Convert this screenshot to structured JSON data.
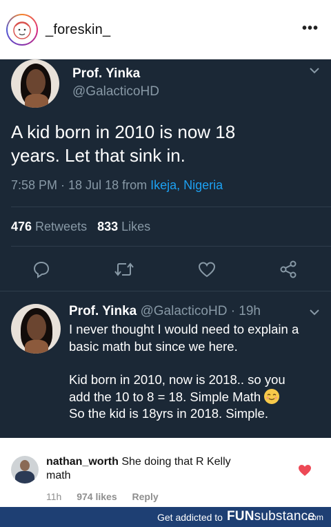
{
  "post": {
    "username": "_foreskin_",
    "more_glyph": "•••"
  },
  "tweet": {
    "author_name": "Prof. Yinka",
    "author_handle": "@GalacticoHD",
    "text_line1": "A kid born in 2010 is now 18",
    "text_line2": "years. Let that sink in.",
    "time": "7:58 PM · 18 Jul 18 from ",
    "location": "Ikeja, Nigeria",
    "retweets_count": "476",
    "retweets_label": " Retweets",
    "likes_count": "833",
    "likes_label": " Likes",
    "icons": [
      "reply-icon",
      "retweet-icon",
      "like-icon",
      "share-icon"
    ]
  },
  "reply": {
    "author_name": "Prof. Yinka",
    "author_handle": "@GalacticoHD · 19h",
    "para1": "I never thought I would need to explain a basic math but since we here.",
    "para2_line1": "Kid born in 2010, now is 2018.. so you",
    "para2_line2": "add the 10 to 8 = 18. Simple Math",
    "para2_line3": "So the kid is 18yrs in 2018. Simple."
  },
  "comment": {
    "username": "nathan_worth",
    "text_part1": " She doing that R Kelly",
    "text_part2": "math",
    "time": "11h",
    "likes": "974 likes",
    "reply_label": "Reply"
  },
  "banner": {
    "text": "Get addicted to",
    "brand_bold": "FUN",
    "brand_thin": "substance",
    "domain": ".com"
  },
  "colors": {
    "tweet_bg": "#1b2836",
    "tweet_secondary": "#8899a6",
    "link_blue": "#1da1f2",
    "heart_red": "#ed4956",
    "banner_bg": "#1e3f73"
  }
}
